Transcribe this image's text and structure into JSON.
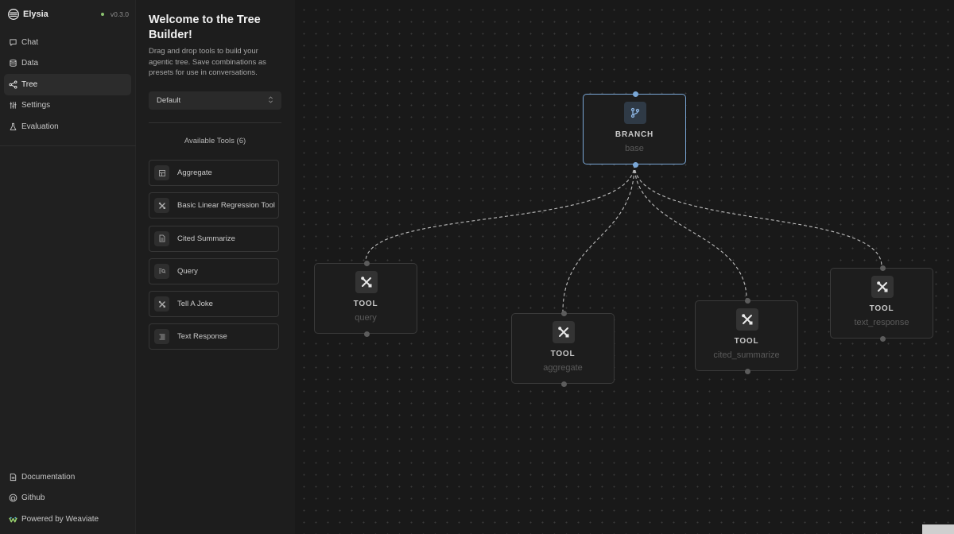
{
  "brand": {
    "name": "Elysia",
    "version": "v0.3.0",
    "logo_icon": "layers-icon",
    "status_color": "#8bc26f"
  },
  "nav": {
    "items": [
      {
        "label": "Chat",
        "icon": "message-square-icon",
        "active": false
      },
      {
        "label": "Data",
        "icon": "database-icon",
        "active": false
      },
      {
        "label": "Tree",
        "icon": "share-nodes-icon",
        "active": true
      },
      {
        "label": "Settings",
        "icon": "sliders-icon",
        "active": false
      },
      {
        "label": "Evaluation",
        "icon": "flask-icon",
        "active": false
      }
    ],
    "footer": [
      {
        "label": "Documentation",
        "icon": "file-icon"
      },
      {
        "label": "Github",
        "icon": "github-icon"
      },
      {
        "label": "Powered by Weaviate",
        "icon": "weaviate-logo-icon"
      }
    ]
  },
  "builder": {
    "title": "Welcome to the Tree Builder!",
    "description": "Drag and drop tools to build your agentic tree. Save combinations as presets for use in conversations.",
    "preset": {
      "selected": "Default"
    },
    "tools_header": "Available Tools (6)",
    "tools": [
      {
        "label": "Aggregate",
        "icon": "table-icon"
      },
      {
        "label": "Basic Linear Regression Tool",
        "icon": "tools-icon"
      },
      {
        "label": "Cited Summarize",
        "icon": "document-icon"
      },
      {
        "label": "Query",
        "icon": "search-list-icon"
      },
      {
        "label": "Tell A Joke",
        "icon": "tools-icon"
      },
      {
        "label": "Text Response",
        "icon": "text-lines-icon"
      }
    ]
  },
  "canvas": {
    "nodes": [
      {
        "id": "branch-base",
        "type": "BRANCH",
        "name": "base",
        "icon": "git-branch-icon",
        "selected": true
      },
      {
        "id": "tool-query",
        "type": "TOOL",
        "name": "query",
        "icon": "tools-icon",
        "selected": false
      },
      {
        "id": "tool-aggregate",
        "type": "TOOL",
        "name": "aggregate",
        "icon": "tools-icon",
        "selected": false
      },
      {
        "id": "tool-cited-summarize",
        "type": "TOOL",
        "name": "cited_summarize",
        "icon": "tools-icon",
        "selected": false
      },
      {
        "id": "tool-text-response",
        "type": "TOOL",
        "name": "text_response",
        "icon": "tools-icon",
        "selected": false
      }
    ],
    "edges": [
      {
        "from": "branch-base",
        "to": "tool-query"
      },
      {
        "from": "branch-base",
        "to": "tool-aggregate"
      },
      {
        "from": "branch-base",
        "to": "tool-cited-summarize"
      },
      {
        "from": "branch-base",
        "to": "tool-text-response"
      }
    ],
    "colors": {
      "selected_accent": "#7aa7d6",
      "edge": "#bdbdbd"
    }
  }
}
